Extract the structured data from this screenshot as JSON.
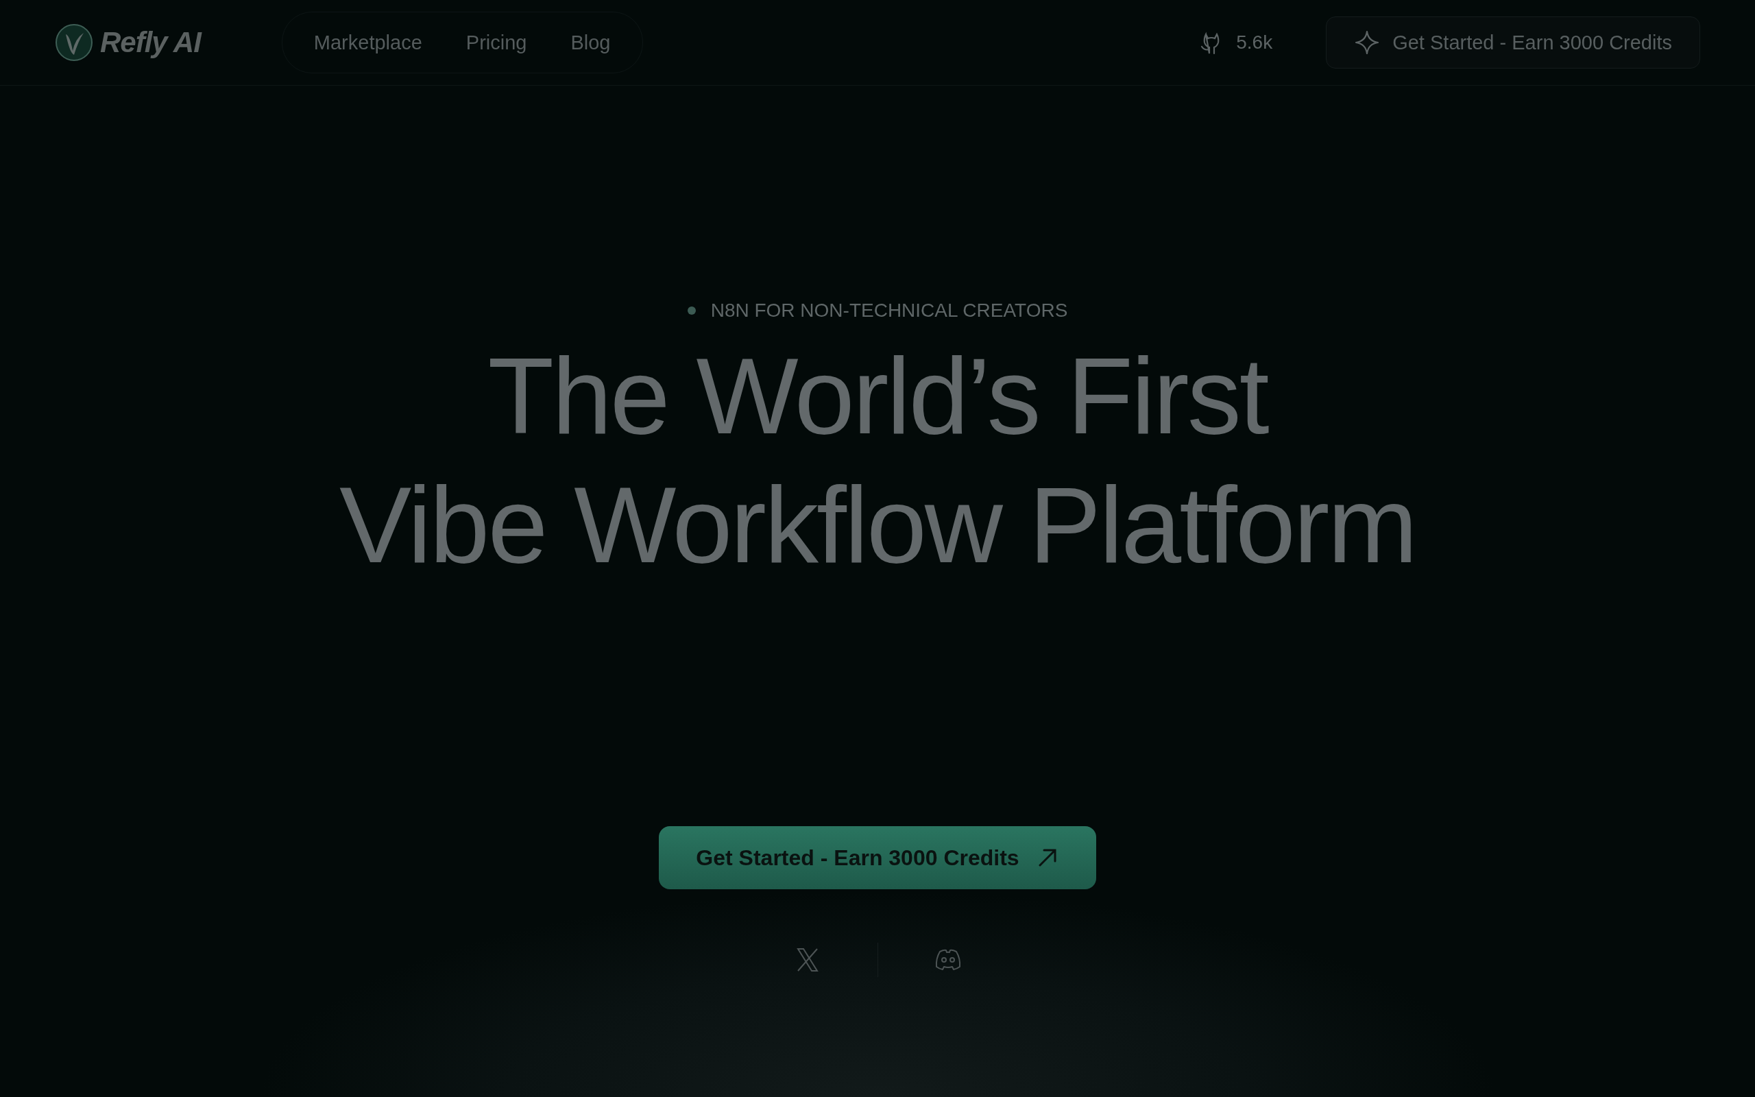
{
  "header": {
    "logo": {
      "text": "Refly AI"
    },
    "nav": [
      {
        "label": "Marketplace"
      },
      {
        "label": "Pricing"
      },
      {
        "label": "Blog"
      }
    ],
    "github": {
      "count": "5.6k"
    },
    "cta": {
      "label": "Get Started - Earn 3000 Credits"
    }
  },
  "hero": {
    "eyebrow": "N8N FOR NON-TECHNICAL CREATORS",
    "headline": [
      "The World’s First",
      "Vibe Workflow Platform"
    ],
    "cta": {
      "label": "Get Started - Earn 3000 Credits"
    },
    "social": [
      {
        "kind": "x"
      },
      {
        "kind": "discord"
      }
    ]
  }
}
